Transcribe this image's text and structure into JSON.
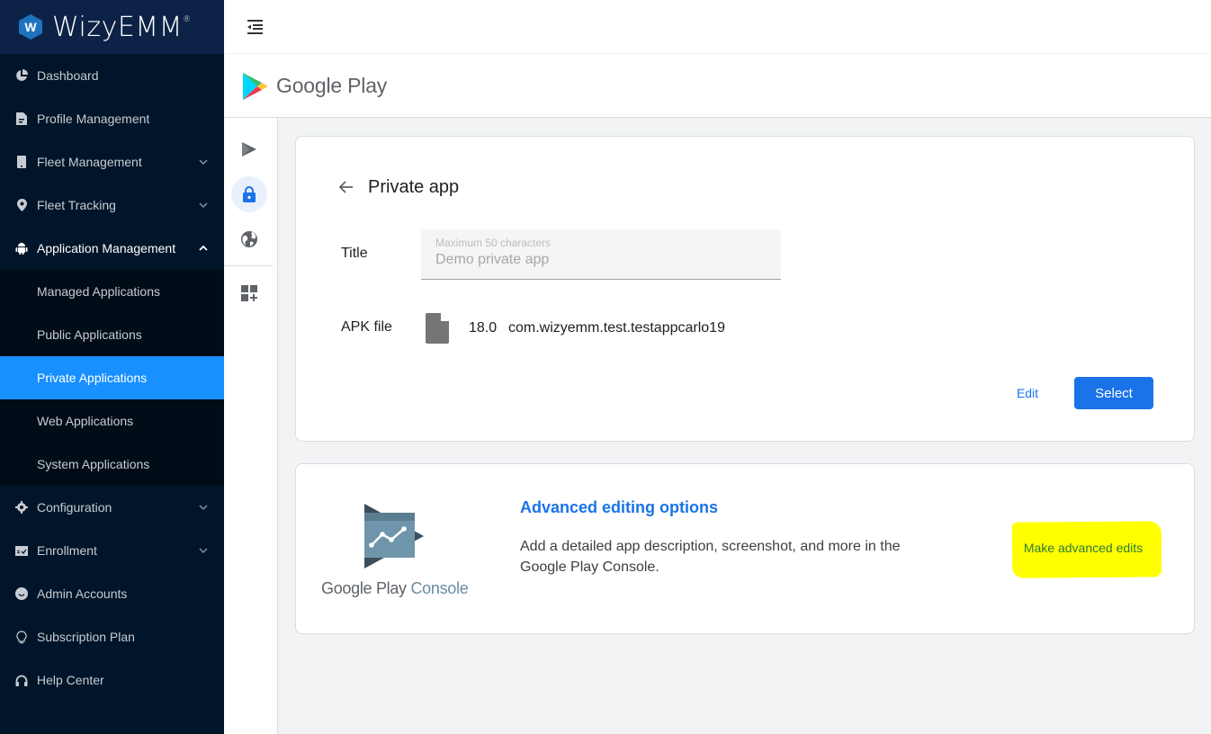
{
  "brand": {
    "name": "WizyEMM",
    "mark": "®",
    "logo_letter": "W"
  },
  "sidebar": {
    "items": [
      {
        "label": "Dashboard",
        "icon": "pie-chart-icon",
        "expandable": false
      },
      {
        "label": "Profile Management",
        "icon": "document-icon",
        "expandable": false
      },
      {
        "label": "Fleet Management",
        "icon": "phone-icon",
        "expandable": true
      },
      {
        "label": "Fleet Tracking",
        "icon": "location-pin-icon",
        "expandable": true
      },
      {
        "label": "Application Management",
        "icon": "android-icon",
        "expandable": true,
        "open": true
      },
      {
        "label": "Configuration",
        "icon": "gear-icon",
        "expandable": true
      },
      {
        "label": "Enrollment",
        "icon": "calendar-check-icon",
        "expandable": true
      },
      {
        "label": "Admin Accounts",
        "icon": "smiley-icon",
        "expandable": false
      },
      {
        "label": "Subscription Plan",
        "icon": "lightbulb-icon",
        "expandable": false
      },
      {
        "label": "Help Center",
        "icon": "headphones-icon",
        "expandable": false
      }
    ],
    "submenu": [
      {
        "label": "Managed Applications"
      },
      {
        "label": "Public Applications"
      },
      {
        "label": "Private Applications",
        "active": true
      },
      {
        "label": "Web Applications"
      },
      {
        "label": "System Applications"
      }
    ]
  },
  "topbar": {
    "menu_toggle_icon": "menu-fold-icon"
  },
  "google_play": {
    "header": "Google Play",
    "rail": [
      {
        "icon": "play-apps-icon",
        "active": false
      },
      {
        "icon": "lock-icon",
        "active": true
      },
      {
        "icon": "globe-icon",
        "active": false
      },
      {
        "icon": "add-widget-icon",
        "active": false
      }
    ]
  },
  "private_app": {
    "title": "Private app",
    "title_label": "Title",
    "title_hint": "Maximum 50 characters",
    "title_value": "Demo private app",
    "apk_label": "APK file",
    "apk_version": "18.0",
    "apk_package": "com.wizyemm.test.testappcarlo19",
    "edit_label": "Edit",
    "select_label": "Select"
  },
  "advanced": {
    "logo_text_main": "Google Play",
    "logo_text_sub": "Console",
    "title": "Advanced editing options",
    "description": "Add a detailed app description, screenshot, and more in the Google Play Console.",
    "action_label": "Make advanced edits",
    "highlight_color": "#ffff00"
  },
  "colors": {
    "sidebar_bg": "#001529",
    "active_item": "#1890ff",
    "primary": "#1a73e8"
  }
}
